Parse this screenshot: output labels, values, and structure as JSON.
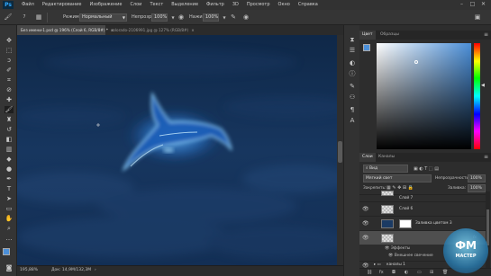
{
  "app": {
    "logo": "Ps"
  },
  "menu": [
    "Файл",
    "Редактирование",
    "Изображение",
    "Слои",
    "Текст",
    "Выделение",
    "Фильтр",
    "3D",
    "Просмотр",
    "Окно",
    "Справка"
  ],
  "options": {
    "brush_size": "7",
    "mode_label": "Режим:",
    "mode_value": "Нормальный",
    "opacity_label": "Непрозр.:",
    "opacity_value": "100%",
    "flow_label": "Нажим:",
    "flow_value": "100%"
  },
  "tabs": [
    {
      "label": "Без имени-1.psd @ 196% (Слой 6, RGB/8#) *",
      "active": true
    },
    {
      "label": "colorado-2106991.jpg @ 127% (RGB/8#)",
      "active": false
    }
  ],
  "status": {
    "zoom": "195,88%",
    "doc": "Док: 14,9M/132,3M"
  },
  "color_panel": {
    "tabs": [
      "Цвет",
      "Образцы"
    ],
    "foreground": "#4b8fd8",
    "background": "#1b3a63"
  },
  "layers_panel": {
    "tabs": [
      "Слои",
      "Каналы"
    ],
    "kind_filter": "Вид",
    "blend_mode": "Мягкий свет",
    "opacity_label": "Непрозрачность:",
    "opacity_value": "100%",
    "lock_label": "Закрепить:",
    "fill_label": "Заливка:",
    "fill_value": "100%",
    "layers": [
      {
        "name": "Слой 7",
        "visible": true,
        "selected": false
      },
      {
        "name": "Слой 6",
        "visible": true,
        "selected": false
      },
      {
        "name": "Заливка цветом 3",
        "visible": true,
        "selected": false
      },
      {
        "name": "",
        "visible": true,
        "selected": true,
        "has_fx": true
      }
    ],
    "effects_label": "Эффекты",
    "effect_item": "Внешнее свечение",
    "group_name": "каналы 1"
  },
  "watermark": {
    "line1": "ФМ",
    "line2": "МАСТЕР"
  },
  "colors": {
    "canvas_dark": "#0d1f3a",
    "canvas_mid": "#1f4a7a",
    "glow": "#3fa0ff"
  }
}
